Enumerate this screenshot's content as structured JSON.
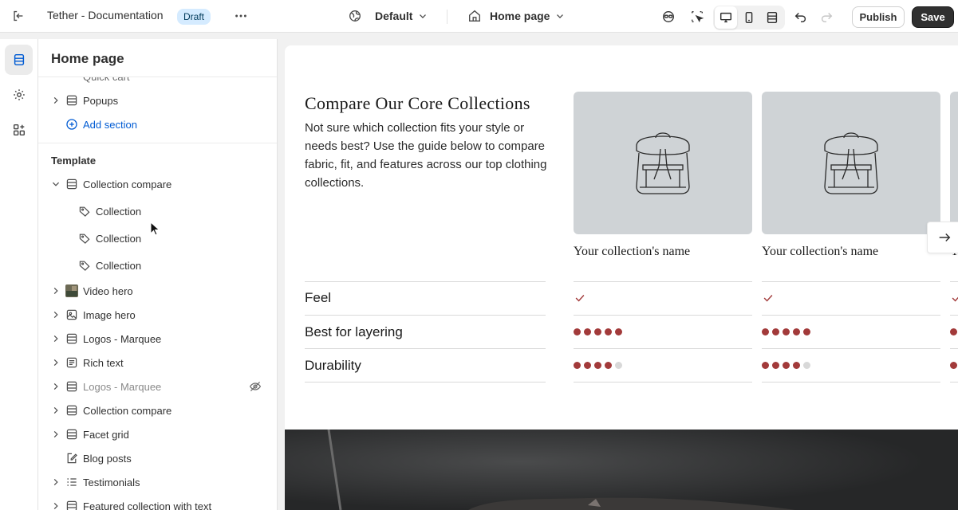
{
  "topbar": {
    "title": "Tether - Documentation",
    "status_badge": "Draft",
    "theme_label": "Default",
    "page_label": "Home page",
    "publish_label": "Publish",
    "save_label": "Save"
  },
  "sidebar": {
    "heading": "Home page",
    "partial_item": "Quick cart",
    "items_top": [
      {
        "label": "Popups",
        "icon": "section-icon"
      }
    ],
    "add_section_label": "Add section",
    "template_heading": "Template",
    "collection_compare": {
      "label": "Collection compare",
      "children": [
        "Collection",
        "Collection",
        "Collection"
      ]
    },
    "sections": [
      {
        "label": "Video hero",
        "icon": "video-thumbnail"
      },
      {
        "label": "Image hero",
        "icon": "image-icon"
      },
      {
        "label": "Logos - Marquee",
        "icon": "section-icon"
      },
      {
        "label": "Rich text",
        "icon": "text-icon"
      },
      {
        "label": "Logos - Marquee",
        "icon": "section-icon",
        "hidden": true
      },
      {
        "label": "Collection compare",
        "icon": "section-icon"
      },
      {
        "label": "Facet grid",
        "icon": "section-icon"
      },
      {
        "label": "Blog posts",
        "icon": "edit-icon"
      },
      {
        "label": "Testimonials",
        "icon": "list-icon"
      },
      {
        "label": "Featured collection with text",
        "icon": "section-icon"
      }
    ]
  },
  "preview": {
    "title": "Compare Our Core Collections",
    "description": "Not sure which collection fits your style or needs best? Use the guide below to compare fabric, fit, and features across our top clothing collections.",
    "cards": [
      "Your collection's name",
      "Your collection's name",
      "Your collection's name"
    ],
    "attributes": [
      {
        "label": "Feel",
        "type": "check"
      },
      {
        "label": "Best for layering",
        "type": "rating",
        "values": [
          5,
          5
        ]
      },
      {
        "label": "Durability",
        "type": "rating",
        "values": [
          4,
          4
        ]
      }
    ],
    "rating_max": 5,
    "accent_color": "#a23a3a"
  }
}
